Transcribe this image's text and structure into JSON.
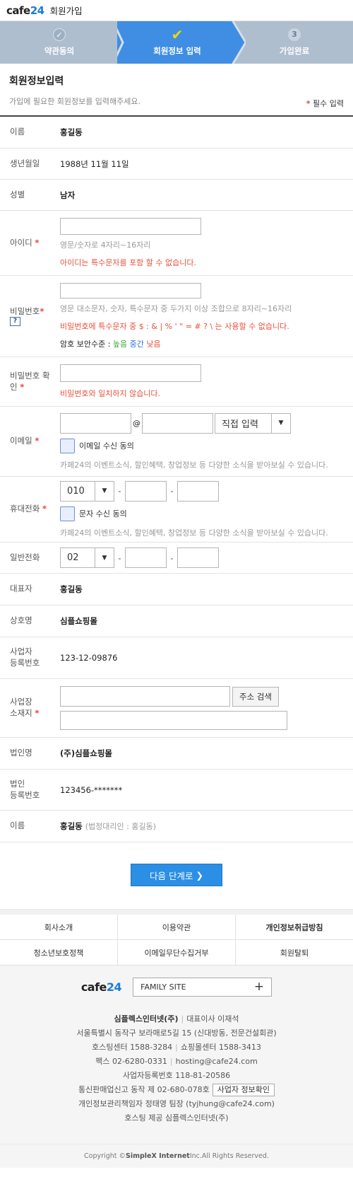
{
  "header": {
    "logo_a": "cafe",
    "logo_b": "24",
    "title": "회원가입"
  },
  "steps": [
    {
      "label": "약관동의",
      "icon": "✓"
    },
    {
      "label": "회원정보 입력",
      "icon": "✔"
    },
    {
      "label": "가입완료",
      "icon": "3"
    }
  ],
  "intro": {
    "title": "회원정보입력",
    "desc": "가입에 필요한 회원정보를 입력해주세요.",
    "star": "*",
    "required": "필수 입력"
  },
  "fields": {
    "name": {
      "label": "이름",
      "value": "홍길동"
    },
    "birth": {
      "label": "생년월일",
      "value": "1988년 11월 11일"
    },
    "gender": {
      "label": "성별",
      "value": "남자"
    },
    "userid": {
      "label": "아이디",
      "value": "",
      "hint": "영문/숫자로 4자리~16자리",
      "error": "아이디는 특수문자를 포함 할 수 없습니다."
    },
    "password": {
      "label": "비밀번호",
      "help": "?",
      "value": "",
      "hint": "영문 대소문자, 숫자, 특수문자 중 두가지 이상 조합으로 8자리~16자리",
      "error": "비밀번호에 특수문자 중 $ : & | % ' \" = # ? \\ 는 사용할 수 없습니다.",
      "strength_label": "암호 보안수준 :",
      "strength_high": "높음",
      "strength_mid": "중간",
      "strength_low": "낮음"
    },
    "password_confirm": {
      "label_1": "비밀번호 확",
      "label_2": "인",
      "value": "",
      "error": "비밀번호와 일치하지 않습니다."
    },
    "email": {
      "label": "이메일",
      "local": "",
      "at": "@",
      "domain": "",
      "select": "직접 입력",
      "consent": "이메일 수신 동의",
      "hint": "카페24의 이벤트소식, 할인혜택, 창업정보 등 다양한 소식을 받아보실 수 있습니다."
    },
    "mobile": {
      "label": "휴대전화",
      "prefix": "010",
      "mid": "",
      "last": "",
      "dash": "-",
      "consent": "문자 수신 동의",
      "hint": "카페24의 이벤트소식, 할인혜택, 창업정보 등 다양한 소식을 받아보실 수 있습니다."
    },
    "phone": {
      "label": "일반전화",
      "prefix": "02",
      "mid": "",
      "last": "",
      "dash": "-"
    },
    "ceo": {
      "label": "대표자",
      "value": "홍길동"
    },
    "company": {
      "label": "상호명",
      "value": "심플쇼핑몰"
    },
    "bizno": {
      "label_1": "사업자",
      "label_2": "등록번호",
      "value": "123-12-09876"
    },
    "address": {
      "label_1": "사업장",
      "label_2": "소재지",
      "button": "주소 검색",
      "line1": "",
      "line2": ""
    },
    "corp_name": {
      "label": "법인명",
      "value": "(주)심플쇼핑몰"
    },
    "corp_no": {
      "label_1": "법인",
      "label_2": "등록번호",
      "value": "123456-*******"
    },
    "rep_name": {
      "label": "이름",
      "value": "홍길동",
      "note": "(법정대리인 : 홍길동)"
    }
  },
  "next_button": {
    "label": "다음 단계로",
    "icon": "❯"
  },
  "footer_links": [
    "회사소개",
    "이용약관",
    "개인정보취급방침",
    "청소년보호정책",
    "이메일무단수집거부",
    "회원탈퇴"
  ],
  "company_info": {
    "family_site": "FAMILY SITE",
    "family_plus": "+",
    "sep": "|",
    "company_name": "심플렉스인터넷(주)",
    "ceo": "대표이사 이재석",
    "address": "서울특별시 동작구 보라매로5길 15 (신대방동, 전문건설회관)",
    "hosting_center": "호스팅센터 1588-3284",
    "shopping_center": "쇼핑몰센터 1588-3413",
    "fax": "팩스 02-6280-0331",
    "email": "hosting@cafe24.com",
    "biz_no": "사업자등록번호 118-81-20586",
    "mail_order": "통신판매업신고 동작 제 02-680-078호",
    "biz_check": "사업자 정보확인",
    "privacy_officer": "개인정보관리책임자 정태영 팀장 (tyjhung@cafe24.com)",
    "hosting_provider": "호스팅 제공 심플렉스인터넷(주)",
    "copyright_1": "Copyright © ",
    "copyright_2": "SimpleX Internet",
    "copyright_3": " Inc.All Rights Reserved."
  },
  "colors": {
    "accent": "#2b8fe5",
    "active_step": "#3f8ee4",
    "step_bg": "#afbecf",
    "error": "#e8513e",
    "strength_high": "#3aa935",
    "strength_mid": "#2f6fd6",
    "strength_low": "#e8513e"
  }
}
